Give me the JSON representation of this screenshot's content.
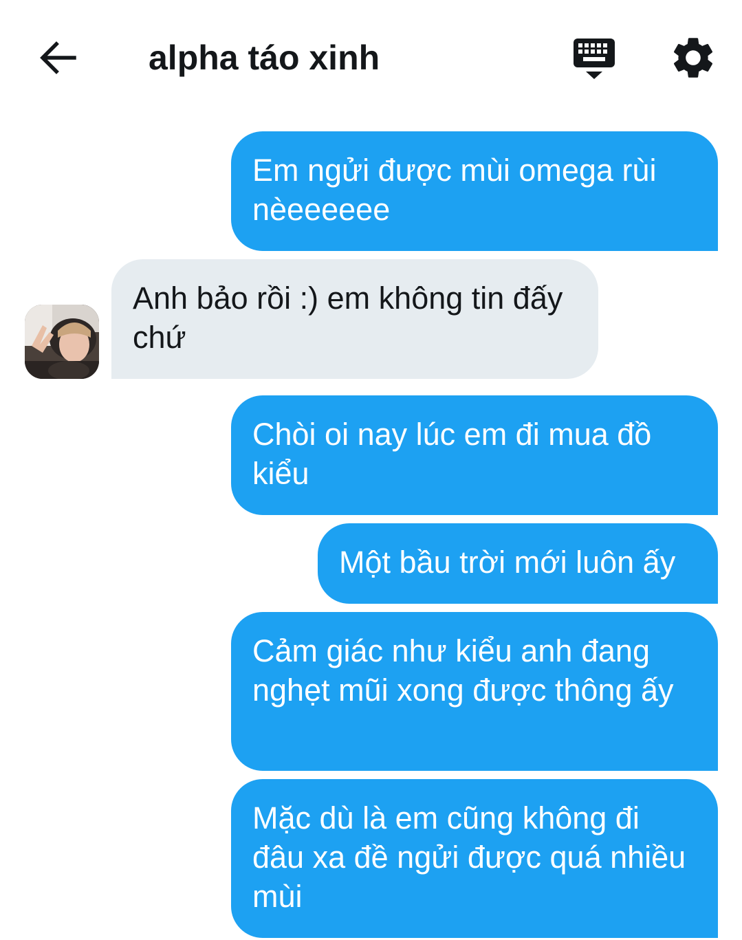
{
  "header": {
    "title": "alpha táo xinh",
    "back_icon": "arrow-left-icon",
    "keyboard_icon": "keyboard-icon",
    "settings_icon": "gear-icon"
  },
  "colors": {
    "sent_bubble": "#1da1f2",
    "received_bubble": "#e6ecf0",
    "text_dark": "#14171a",
    "text_light": "#ffffff"
  },
  "messages": [
    {
      "direction": "sent",
      "text": "Em ngửi được mùi omega rùi nèeeeeee"
    },
    {
      "direction": "received",
      "text": "Anh bảo rồi :) em không tin đấy chứ"
    },
    {
      "direction": "sent",
      "text": "Chòi oi nay lúc em đi mua đồ kiểu"
    },
    {
      "direction": "sent",
      "text": "Một bầu trời mới luôn ấy"
    },
    {
      "direction": "sent",
      "text": "Cảm giác như kiểu anh đang nghẹt mũi xong được thông ấy"
    },
    {
      "direction": "sent",
      "text": "Mặc dù là em cũng không đi đâu xa đề ngửi được quá nhiều mùi"
    }
  ]
}
